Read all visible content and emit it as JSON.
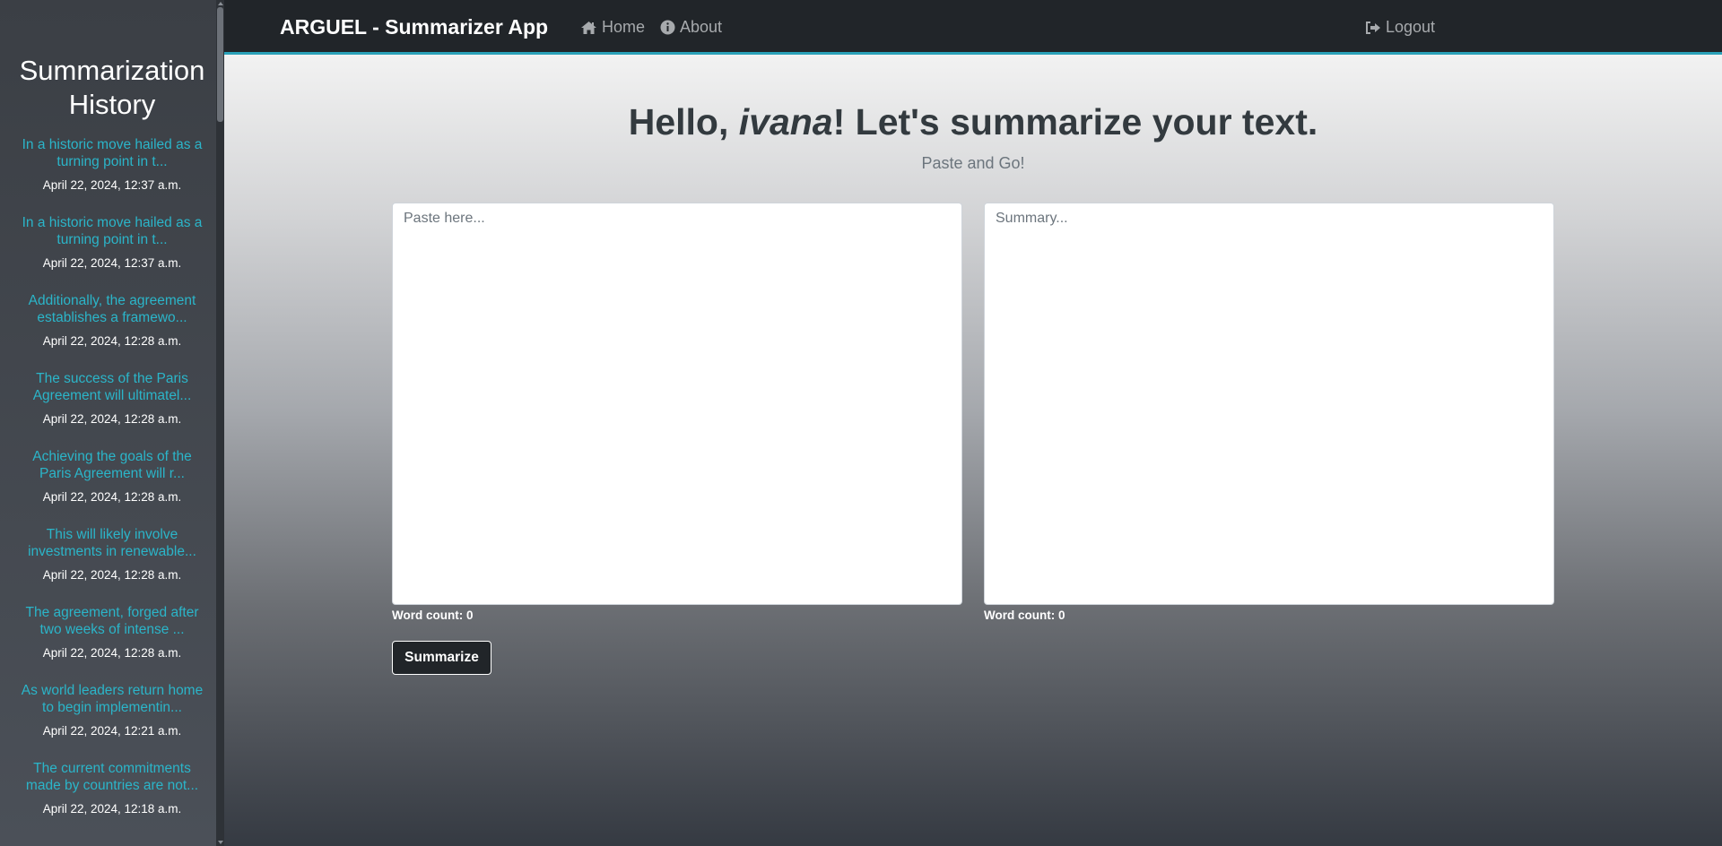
{
  "sidebar": {
    "title_line1": "Summarization",
    "title_line2": "History",
    "items": [
      {
        "preview": "In a historic move hailed as a turning point in t...",
        "date": "April 22, 2024, 12:37 a.m."
      },
      {
        "preview": "In a historic move hailed as a turning point in t...",
        "date": "April 22, 2024, 12:37 a.m."
      },
      {
        "preview": "Additionally, the agreement establishes a framewo...",
        "date": "April 22, 2024, 12:28 a.m."
      },
      {
        "preview": "The success of the Paris Agreement will ultimatel...",
        "date": "April 22, 2024, 12:28 a.m."
      },
      {
        "preview": "Achieving the goals of the Paris Agreement will r...",
        "date": "April 22, 2024, 12:28 a.m."
      },
      {
        "preview": "This will likely involve investments in renewable...",
        "date": "April 22, 2024, 12:28 a.m."
      },
      {
        "preview": "The agreement, forged after two weeks of intense ...",
        "date": "April 22, 2024, 12:28 a.m."
      },
      {
        "preview": "As world leaders return home to begin implementin...",
        "date": "April 22, 2024, 12:21 a.m."
      },
      {
        "preview": "The current commitments made by countries are not...",
        "date": "April 22, 2024, 12:18 a.m."
      }
    ]
  },
  "navbar": {
    "brand": "ARGUEL - Summarizer App",
    "home": "Home",
    "about": "About",
    "logout": "Logout"
  },
  "main": {
    "greeting_prefix": "Hello, ",
    "username": "ivana",
    "greeting_suffix": "! Let's summarize your text.",
    "subtitle": "Paste and Go!",
    "input_placeholder": "Paste here...",
    "summary_placeholder": "Summary...",
    "input_word_count": "Word count: 0",
    "summary_word_count": "Word count: 0",
    "summarize_button": "Summarize"
  },
  "colors": {
    "accent": "#2aa1b8",
    "link": "#2bb5c9",
    "navbar_bg": "#212529"
  }
}
